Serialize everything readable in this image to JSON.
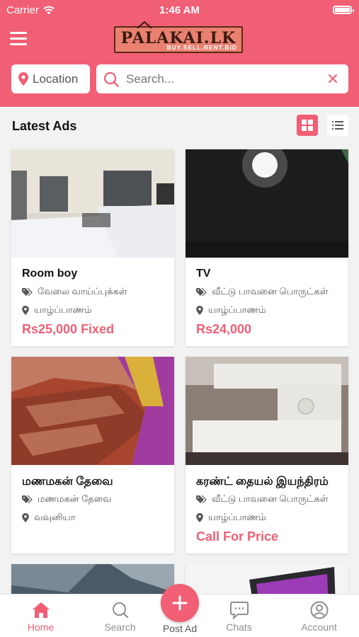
{
  "status_bar": {
    "carrier": "Carrier",
    "time": "1:46 AM"
  },
  "header": {
    "logo_main": "PALAKAI.LK",
    "logo_sub": "BUY.SELL.RENT.BID",
    "accent_color": "#f15f75"
  },
  "filters": {
    "location_label": "Location",
    "search_placeholder": "Search..."
  },
  "section": {
    "title": "Latest Ads",
    "view_mode": "grid"
  },
  "ads": [
    {
      "title": "Room boy",
      "category": "வேலை வாய்ப்புக்கள்",
      "location": "யாழ்ப்பாணம்",
      "price": "Rs25,000 Fixed"
    },
    {
      "title": "TV",
      "category": "வீட்டு பாவனை பொருட்கள்",
      "location": "யாழ்ப்பாணம்",
      "price": "Rs24,000"
    },
    {
      "title": "மணமகன் தேவை",
      "category": "மணமகன் தேவை",
      "location": "வவுனியா",
      "price": ""
    },
    {
      "title": "கரண்ட் தையல் இயந்திரம்",
      "category": "வீட்டு பாவனை பொருட்கள்",
      "location": "யாழ்ப்பாணம்",
      "price": "Call For Price"
    }
  ],
  "tabbar": {
    "home": "Home",
    "search": "Search",
    "post_ad": "Post Ad",
    "chats": "Chats",
    "account": "Account",
    "active": "home"
  }
}
